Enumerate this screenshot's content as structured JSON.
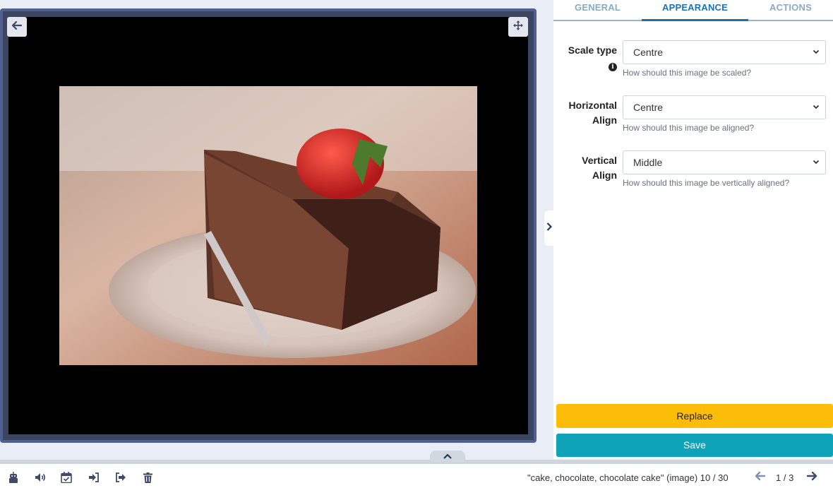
{
  "preview": {
    "back_icon": "arrow-left-icon",
    "move_icon": "move-arrows-icon",
    "image_subject": "chocolate cake with strawberry"
  },
  "tabs": [
    {
      "label": "GENERAL",
      "active": false
    },
    {
      "label": "APPEARANCE",
      "active": true
    },
    {
      "label": "ACTIONS",
      "active": false
    }
  ],
  "fields": {
    "scale": {
      "label_line1": "Scale type",
      "value": "Centre",
      "help": "How should this image be scaled?",
      "info_icon": "info-circle-icon"
    },
    "halign": {
      "label_line1": "Horizontal",
      "label_line2": "Align",
      "value": "Centre",
      "help": "How should this image be aligned?"
    },
    "valign": {
      "label_line1": "Vertical",
      "label_line2": "Align",
      "value": "Middle",
      "help": "How should this image be vertically aligned?"
    }
  },
  "buttons": {
    "replace": "Replace",
    "save": "Save"
  },
  "colors": {
    "replace_bg": "#fbbd08",
    "save_bg": "#0ea3b8",
    "active_tab": "#1a73b8"
  },
  "bottom": {
    "caption": "\"cake, chocolate, chocolate cake\" (image) 10 / 30",
    "pager": "1 / 3",
    "tools": [
      "robot-icon",
      "volume-icon",
      "calendar-check-icon",
      "sign-in-icon",
      "sign-out-icon",
      "trash-icon"
    ]
  }
}
